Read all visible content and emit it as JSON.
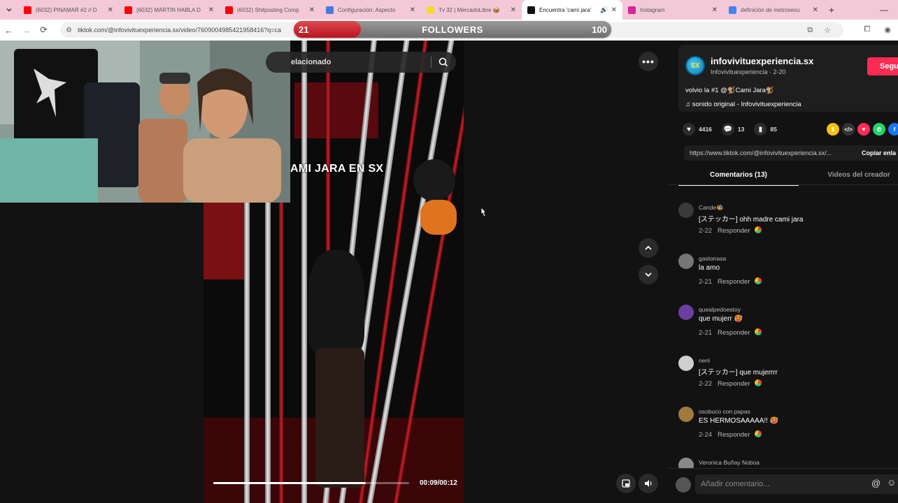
{
  "browser": {
    "tabs": [
      {
        "title": "(6032) PINAMAR #2 // D",
        "favicon_color": "#ff0000",
        "icon": "youtube-icon",
        "active": false
      },
      {
        "title": "(6032) MARTIN HABLA D",
        "favicon_color": "#ff0000",
        "icon": "youtube-icon",
        "active": false
      },
      {
        "title": "(6032) Shitposting Comp",
        "favicon_color": "#ff0000",
        "icon": "youtube-icon",
        "active": false
      },
      {
        "title": "Configuración: Aspecto",
        "favicon_color": "#4a7bd8",
        "icon": "gear-icon",
        "active": false
      },
      {
        "title": "Tv 32 | MercadoLibre 📦",
        "favicon_color": "#f5d92d",
        "icon": "mercadolibre-icon",
        "active": false
      },
      {
        "title": "Encuentra 'cami jara'",
        "favicon_color": "#111111",
        "icon": "tiktok-icon",
        "active": true
      },
      {
        "title": "Instagram",
        "favicon_color": "#d6249f",
        "icon": "instagram-icon",
        "active": false
      },
      {
        "title": "definición de metrosexu",
        "favicon_color": "#4285f4",
        "icon": "google-icon",
        "active": false
      }
    ],
    "url": "tiktok.com/@infovivituexperiencia.sx/video/7609004985421958416?q=ca",
    "url_tail": "7978799"
  },
  "followers_overlay": {
    "current": "21",
    "label": "FOLLOWERS",
    "goal": "100",
    "progress": 0.21,
    "fill_color": "#c8202a"
  },
  "video": {
    "caption": "AMI JARA EN SX",
    "search_text": "elacionado",
    "time": "00:09/00:12",
    "progress": 0.78
  },
  "creator": {
    "avatar_text": "SX",
    "name": "infovivituexperiencia.sx",
    "sub": "Infovivituexperiencia · 2-20",
    "follow_label": "Segui"
  },
  "post": {
    "description": "volvio la #1 @🐒Cami Jara🐒",
    "sound": "sonido original - Infovivituexperiencia",
    "likes": "4416",
    "comments": "13",
    "saves": "85",
    "link": "https://www.tiktok.com/@infovivituexperiencia.sx/...",
    "copy_label": "Copiar enla"
  },
  "panel_tabs": {
    "comments": "Comentarios (13)",
    "creator_videos": "Videos del creador"
  },
  "comments": [
    {
      "user": "Cande🐝",
      "text": "[ステッカー] ohh madre cami jara",
      "date": "2-22",
      "reply": "Responder",
      "avatar_color": "#3a3a3a"
    },
    {
      "user": "gastonasa",
      "text": "la amo",
      "date": "2-21",
      "reply": "Responder",
      "avatar_color": "#777777"
    },
    {
      "user": "quealpedoestoy",
      "text": "que mujerr 🥵",
      "date": "2-21",
      "reply": "Responder",
      "avatar_color": "#6a3fa0"
    },
    {
      "user": "nerii",
      "text": "[ステッカー] que mujerrrr",
      "date": "2-22",
      "reply": "Responder",
      "avatar_color": "#cfcfcf"
    },
    {
      "user": "osobuco con papas",
      "text": "ES HERMOSAAAAA!! 🥵",
      "date": "2-24",
      "reply": "Responder",
      "avatar_color": "#a07a3a"
    },
    {
      "user": "Veronica Buñay Noboa",
      "text": "",
      "date": "",
      "reply": "",
      "avatar_color": "#888888"
    }
  ],
  "comment_box": {
    "placeholder": "Añadir comentario..."
  },
  "colors": {
    "brand_pink": "#fe2c55",
    "background": "#121212",
    "tab_strip": "#f3c9d8"
  }
}
